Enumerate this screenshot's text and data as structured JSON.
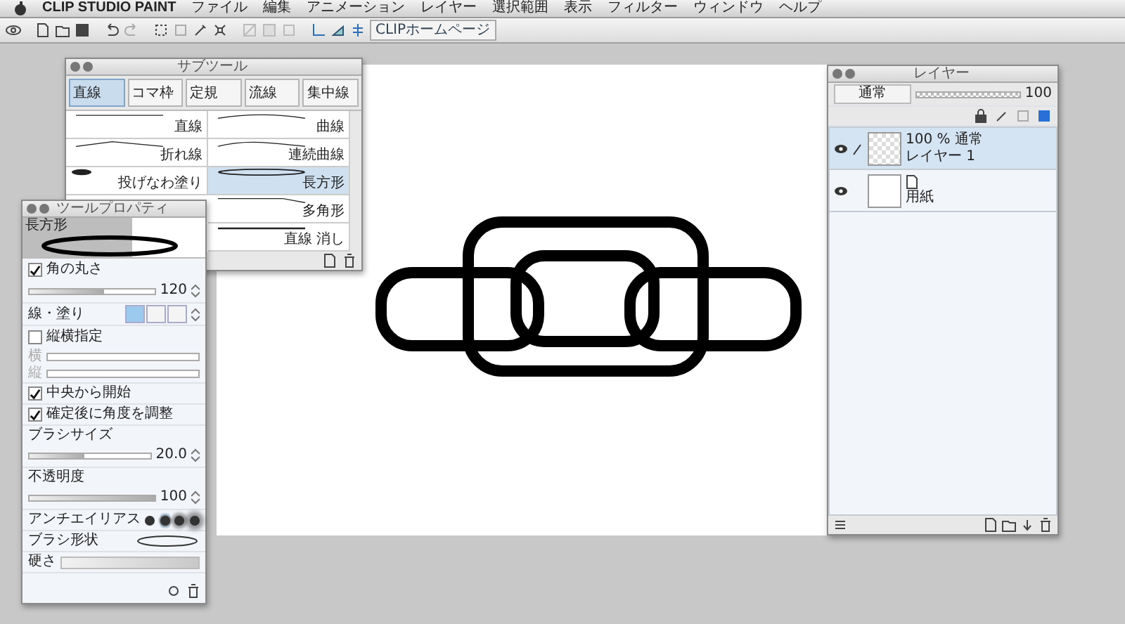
{
  "menu": {
    "app": "CLIP STUDIO PAINT",
    "items": [
      "ファイル",
      "編集",
      "アニメーション",
      "レイヤー",
      "選択範囲",
      "表示",
      "フィルター",
      "ウィンドウ",
      "ヘルプ"
    ]
  },
  "toolbar": {
    "link": "CLIPホームページ"
  },
  "subtool": {
    "title": "サブツール",
    "tabs": [
      {
        "label": "直線",
        "selected": true
      },
      {
        "label": "コマ枠",
        "selected": false
      },
      {
        "label": "定規",
        "selected": false
      },
      {
        "label": "流線",
        "selected": false
      },
      {
        "label": "集中線",
        "selected": false
      }
    ],
    "brushes": [
      {
        "label": "直線",
        "kind": "line",
        "selected": false
      },
      {
        "label": "曲線",
        "kind": "curve",
        "selected": false
      },
      {
        "label": "折れ線",
        "kind": "polyline",
        "selected": false
      },
      {
        "label": "連続曲線",
        "kind": "continuous_curve",
        "selected": false
      },
      {
        "label": "投げなわ塗り",
        "kind": "lasso_fill",
        "selected": false
      },
      {
        "label": "長方形",
        "kind": "ellipse",
        "selected": true
      },
      {
        "label": "多角形",
        "kind": "polygon",
        "selected": false
      },
      {
        "label": "直線 消し",
        "kind": "line_erase",
        "selected": false
      }
    ]
  },
  "tool_property": {
    "title": "ツールプロパティ",
    "tool_name": "長方形",
    "corner": {
      "label": "角の丸さ",
      "checked": true,
      "value": "120",
      "level": 0.6
    },
    "line_fill": {
      "label": "線・塗り",
      "modes": [
        {
          "selected": true
        },
        {
          "selected": false
        },
        {
          "selected": false
        }
      ]
    },
    "aspect": {
      "label": "縦横指定",
      "checked": false,
      "fields": [
        "横",
        "縦"
      ]
    },
    "options": [
      {
        "label": "中央から開始",
        "checked": true
      },
      {
        "label": "確定後に角度を調整",
        "checked": true
      }
    ],
    "brush_size": {
      "label": "ブラシサイズ",
      "value": "20.0",
      "level": 0.45
    },
    "opacity": {
      "label": "不透明度",
      "value": "100",
      "level": 1
    },
    "antialias": {
      "label": "アンチエイリアス",
      "options": [
        {
          "selected": false
        },
        {
          "selected": true
        },
        {
          "selected": false
        },
        {
          "selected": false
        }
      ]
    },
    "brush_shape": {
      "label": "ブラシ形状"
    },
    "hardness": {
      "label": "硬さ"
    }
  },
  "layers": {
    "title": "レイヤー",
    "blend": "通常",
    "opacity": "100",
    "opacity_slider": {
      "level": 1
    },
    "items": [
      {
        "info": "100 % 通常",
        "name": "レイヤー 1",
        "selected": true,
        "visible": true,
        "kind": "raster"
      },
      {
        "name": "用紙",
        "selected": false,
        "visible": true,
        "kind": "paper"
      }
    ]
  }
}
